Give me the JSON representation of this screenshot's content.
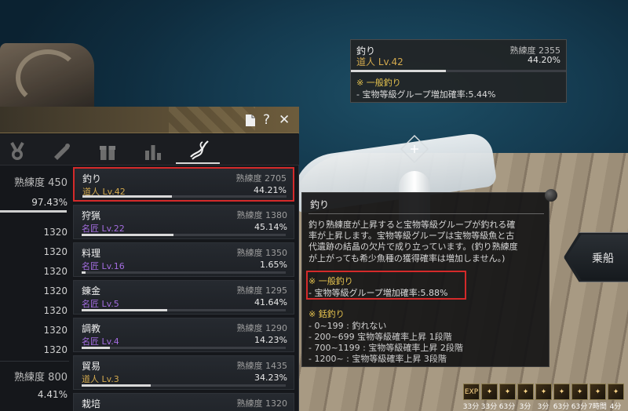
{
  "window_controls": {
    "doc_icon": "document-icon",
    "help": "?",
    "close": "✕"
  },
  "categories": [
    {
      "icon": "medal-icon",
      "active": false
    },
    {
      "icon": "scroll-icon",
      "active": false
    },
    {
      "icon": "gift-icon",
      "active": false
    },
    {
      "icon": "bar-chart-icon",
      "active": false
    },
    {
      "icon": "fishing-icon",
      "active": true
    }
  ],
  "left_column": {
    "header_label": "熟練度 450",
    "header_pct": "97.43%",
    "bar_fill_fraction": 0.97,
    "values": [
      "1320",
      "1320",
      "1320",
      "1320",
      "1320",
      "1320",
      "1320"
    ],
    "footer_label": "熟練度 800",
    "footer_pct": "4.41%"
  },
  "skills": [
    {
      "name": "釣り",
      "rank": "道人 Lv.42",
      "rank_color": "gold",
      "mastery": "熟練度 2705",
      "pct": "44.21%",
      "fill": 0.44,
      "selected": true
    },
    {
      "name": "狩猟",
      "rank": "名匠 Lv.22",
      "rank_color": "purple",
      "mastery": "熟練度 1380",
      "pct": "45.14%",
      "fill": 0.45,
      "selected": false
    },
    {
      "name": "料理",
      "rank": "名匠 Lv.16",
      "rank_color": "purple",
      "mastery": "熟練度 1350",
      "pct": "1.65%",
      "fill": 0.02,
      "selected": false
    },
    {
      "name": "錬金",
      "rank": "名匠 Lv.5",
      "rank_color": "purple",
      "mastery": "熟練度 1295",
      "pct": "41.64%",
      "fill": 0.42,
      "selected": false
    },
    {
      "name": "調教",
      "rank": "名匠 Lv.4",
      "rank_color": "purple",
      "mastery": "熟練度 1290",
      "pct": "14.23%",
      "fill": 0.14,
      "selected": false
    },
    {
      "name": "貿易",
      "rank": "道人 Lv.3",
      "rank_color": "gold",
      "mastery": "熟練度 1435",
      "pct": "34.23%",
      "fill": 0.34,
      "selected": false
    },
    {
      "name": "栽培",
      "rank": "",
      "rank_color": "gold",
      "mastery": "熟練度 1320",
      "pct": "",
      "fill": 0.0,
      "selected": false
    }
  ],
  "mini_panel": {
    "name": "釣り",
    "rank": "道人 Lv.42",
    "mastery": "熟練度 2355",
    "pct": "44.20%",
    "fill": 0.44,
    "section": "※ 一般釣り",
    "detail": "- 宝物等級グループ増加確率:5.44%"
  },
  "tooltip": {
    "title": "釣り",
    "desc_line1": "釣り熟練度が上昇すると宝物等級グループが釣れる確",
    "desc_line2": "率が上昇します。宝物等級グループは宝物等級魚と古",
    "desc_line3": "代遺跡の結晶の欠片で成り立っています。(釣り熟練度",
    "desc_line4": "が上がっても希少魚種の獲得確率は増加しません。)",
    "general_title": "※ 一般釣り",
    "general_detail": "- 宝物等級グループ増加確率:5.88%",
    "harpoon_title": "※ 銛釣り",
    "tiers": [
      "- 0~199 : 釣れない",
      "- 200~699 宝物等級確率上昇 1段階",
      "- 700~1199 : 宝物等級確率上昇 2段階",
      "- 1200~ : 宝物等級確率上昇 3段階"
    ]
  },
  "board_button": {
    "label": "乗船"
  },
  "buffs": [
    {
      "label": "EXP",
      "time": "33分"
    },
    {
      "label": "✦",
      "time": "33分"
    },
    {
      "label": "✦",
      "time": "63分"
    },
    {
      "label": "✦",
      "time": "3分"
    },
    {
      "label": "✦",
      "time": "3分"
    },
    {
      "label": "✦",
      "time": "63分"
    },
    {
      "label": "✦",
      "time": "63分"
    },
    {
      "label": "✦",
      "time": "7時間"
    },
    {
      "label": "✦",
      "time": "4分"
    }
  ]
}
